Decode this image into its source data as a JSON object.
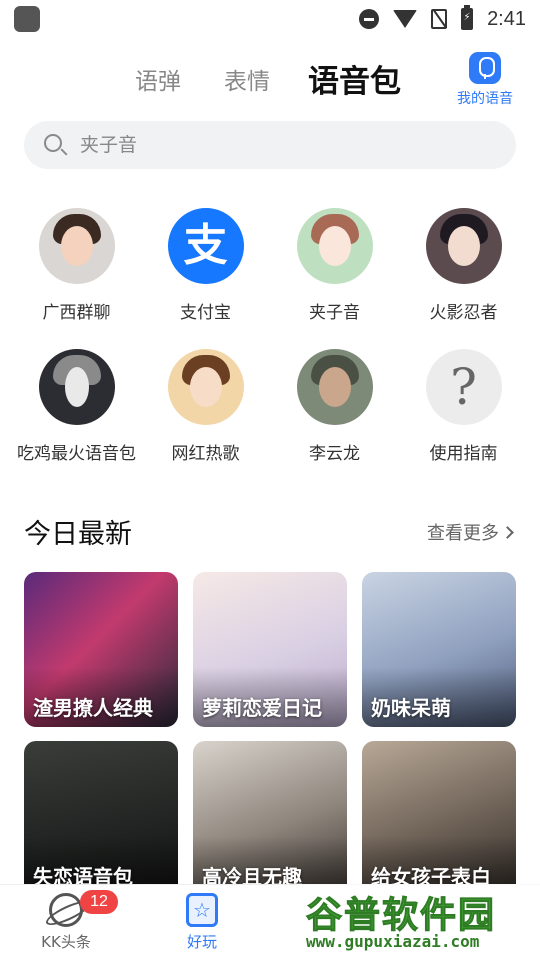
{
  "status_bar": {
    "time": "2:41",
    "icons": [
      "app-icon",
      "do-not-disturb-icon",
      "wifi-icon",
      "no-sim-icon",
      "battery-charging-icon"
    ]
  },
  "tabs": [
    {
      "label": "语弹",
      "active": false
    },
    {
      "label": "表情",
      "active": false
    },
    {
      "label": "语音包",
      "active": true
    }
  ],
  "my_voice": {
    "label": "我的语音",
    "icon": "mic-icon"
  },
  "search": {
    "placeholder": "夹子音",
    "value": ""
  },
  "categories": [
    {
      "label": "广西群聊",
      "icon": "avatar-boy-glasses"
    },
    {
      "label": "支付宝",
      "icon": "alipay-logo",
      "glyph": "支",
      "color": "#1677ff"
    },
    {
      "label": "夹子音",
      "icon": "avatar-anime-girl"
    },
    {
      "label": "火影忍者",
      "icon": "avatar-anime-dark-hair"
    },
    {
      "label": "吃鸡最火语音包",
      "icon": "avatar-helmet-character"
    },
    {
      "label": "网红热歌",
      "icon": "avatar-girl-photo"
    },
    {
      "label": "李云龙",
      "icon": "avatar-soldier"
    },
    {
      "label": "使用指南",
      "icon": "question-mark-icon",
      "glyph": "?"
    }
  ],
  "section": {
    "title": "今日最新",
    "see_more": "查看更多"
  },
  "cards": [
    {
      "label": "渣男撩人经典"
    },
    {
      "label": "萝莉恋爱日记"
    },
    {
      "label": "奶味呆萌"
    },
    {
      "label": "失恋语音包"
    },
    {
      "label": "高冷且无趣"
    },
    {
      "label": "给女孩子表白"
    }
  ],
  "bottom_nav": [
    {
      "label": "KK头条",
      "icon": "planet-icon",
      "badge": "12",
      "active": false
    },
    {
      "label": "好玩",
      "icon": "star-icon",
      "active": true
    }
  ],
  "watermark": {
    "title": "谷普软件园",
    "url": "www.gupuxiazai.com"
  },
  "colors": {
    "accent": "#2f7af6",
    "tab_highlight": "#ffd83a",
    "badge": "#f04444",
    "alipay": "#1677ff"
  }
}
